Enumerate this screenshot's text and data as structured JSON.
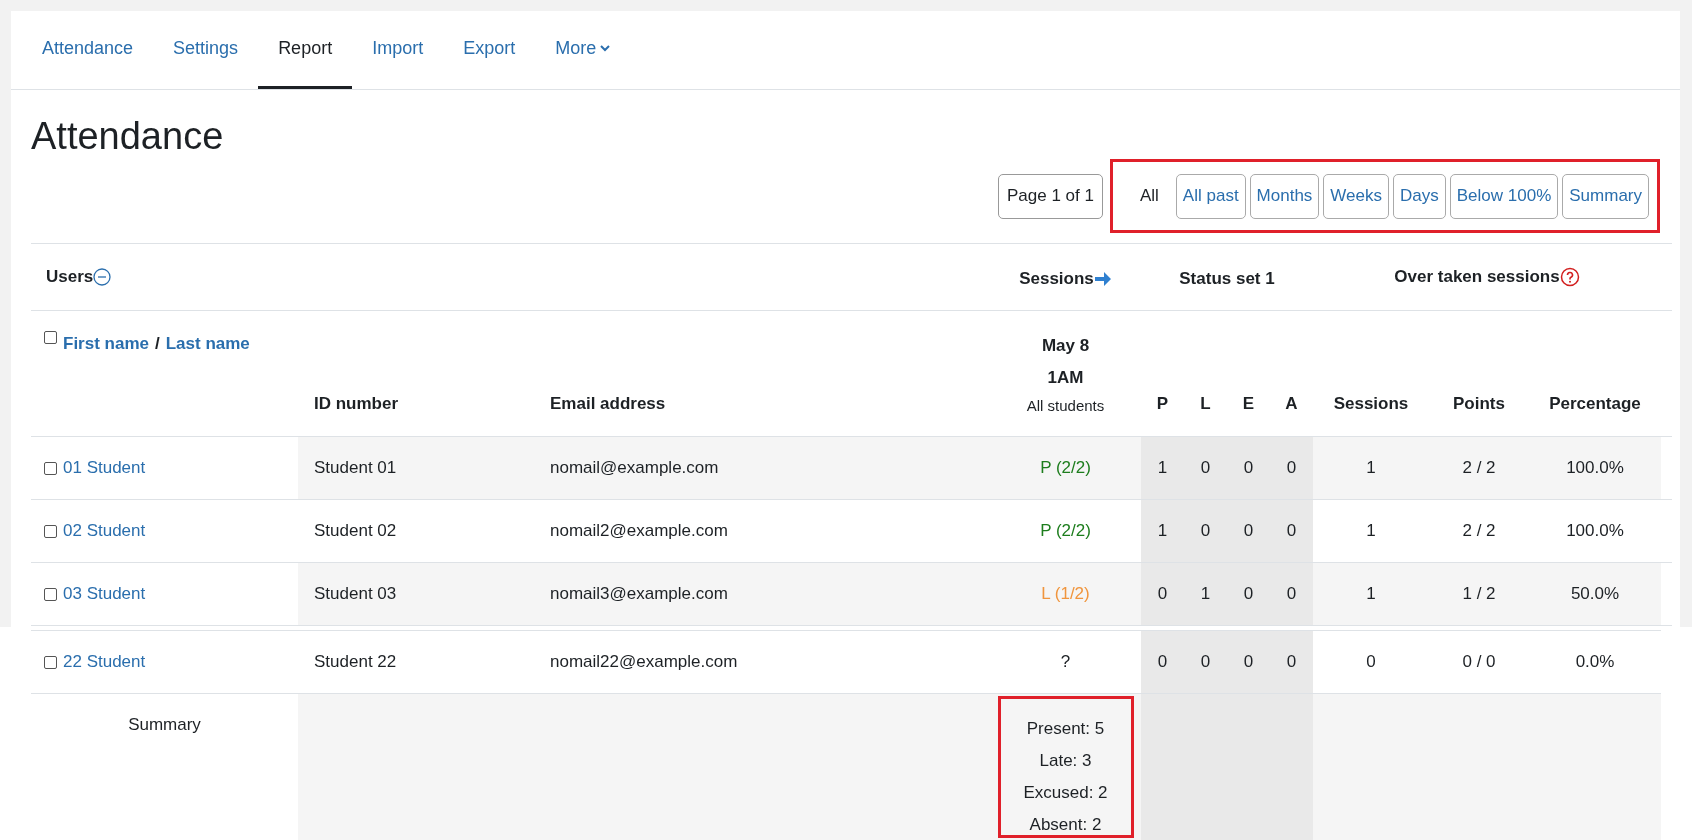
{
  "tabs": [
    {
      "label": "Attendance",
      "selected": false
    },
    {
      "label": "Settings",
      "selected": false
    },
    {
      "label": "Report",
      "selected": true
    },
    {
      "label": "Import",
      "selected": false
    },
    {
      "label": "Export",
      "selected": false
    },
    {
      "label": "More",
      "selected": false,
      "dropdown": true
    }
  ],
  "title": "Attendance",
  "pager": "Page 1 of 1",
  "filters": {
    "highlighted": true,
    "items": [
      {
        "label": "All",
        "selected": true
      },
      {
        "label": "All past",
        "selected": false
      },
      {
        "label": "Months",
        "selected": false
      },
      {
        "label": "Weeks",
        "selected": false
      },
      {
        "label": "Days",
        "selected": false
      },
      {
        "label": "Below 100%",
        "selected": false
      },
      {
        "label": "Summary",
        "selected": false
      }
    ]
  },
  "table": {
    "group_headers": {
      "users": "Users",
      "sessions": "Sessions",
      "status_set": "Status set 1",
      "over_taken": "Over taken sessions"
    },
    "name_header": {
      "first": "First name",
      "separator": "/",
      "last": "Last name",
      "checked": false
    },
    "columns": {
      "id": "ID number",
      "email": "Email address",
      "session_date": "May 8",
      "session_time": "1AM",
      "session_group": "All students",
      "statuses": [
        "P",
        "L",
        "E",
        "A"
      ],
      "sessions": "Sessions",
      "points": "Points",
      "percentage": "Percentage"
    },
    "rows": [
      {
        "name": "01 Student",
        "checked": false,
        "id": "Student 01",
        "email": "nomail@example.com",
        "session": {
          "text": "P (2/2)",
          "kind": "present"
        },
        "counts": [
          "1",
          "0",
          "0",
          "0"
        ],
        "sessions": "1",
        "points": "2 / 2",
        "percentage": "100.0%"
      },
      {
        "name": "02 Student",
        "checked": false,
        "id": "Student 02",
        "email": "nomail2@example.com",
        "session": {
          "text": "P (2/2)",
          "kind": "present"
        },
        "counts": [
          "1",
          "0",
          "0",
          "0"
        ],
        "sessions": "1",
        "points": "2 / 2",
        "percentage": "100.0%"
      },
      {
        "name": "03 Student",
        "checked": false,
        "id": "Student 03",
        "email": "nomail3@example.com",
        "session": {
          "text": "L (1/2)",
          "kind": "late"
        },
        "counts": [
          "0",
          "1",
          "0",
          "0"
        ],
        "sessions": "1",
        "points": "1 / 2",
        "percentage": "50.0%"
      }
    ],
    "rows_continued": [
      {
        "name": "22 Student",
        "checked": false,
        "id": "Student 22",
        "email": "nomail22@example.com",
        "session": {
          "text": "?",
          "kind": "unknown"
        },
        "counts": [
          "0",
          "0",
          "0",
          "0"
        ],
        "sessions": "0",
        "points": "0 / 0",
        "percentage": "0.0%"
      }
    ],
    "summary": {
      "label": "Summary",
      "highlighted": true,
      "lines": [
        "Present: 5",
        "Late: 3",
        "Excused: 2",
        "Absent: 2"
      ]
    }
  }
}
